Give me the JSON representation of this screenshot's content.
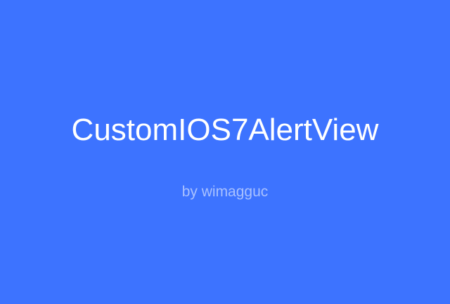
{
  "banner": {
    "title": "CustomIOS7AlertView",
    "byline": "by wimagguc",
    "colors": {
      "background": "#3d73ff",
      "title": "#ffffff",
      "byline": "#a9c1ff"
    }
  }
}
